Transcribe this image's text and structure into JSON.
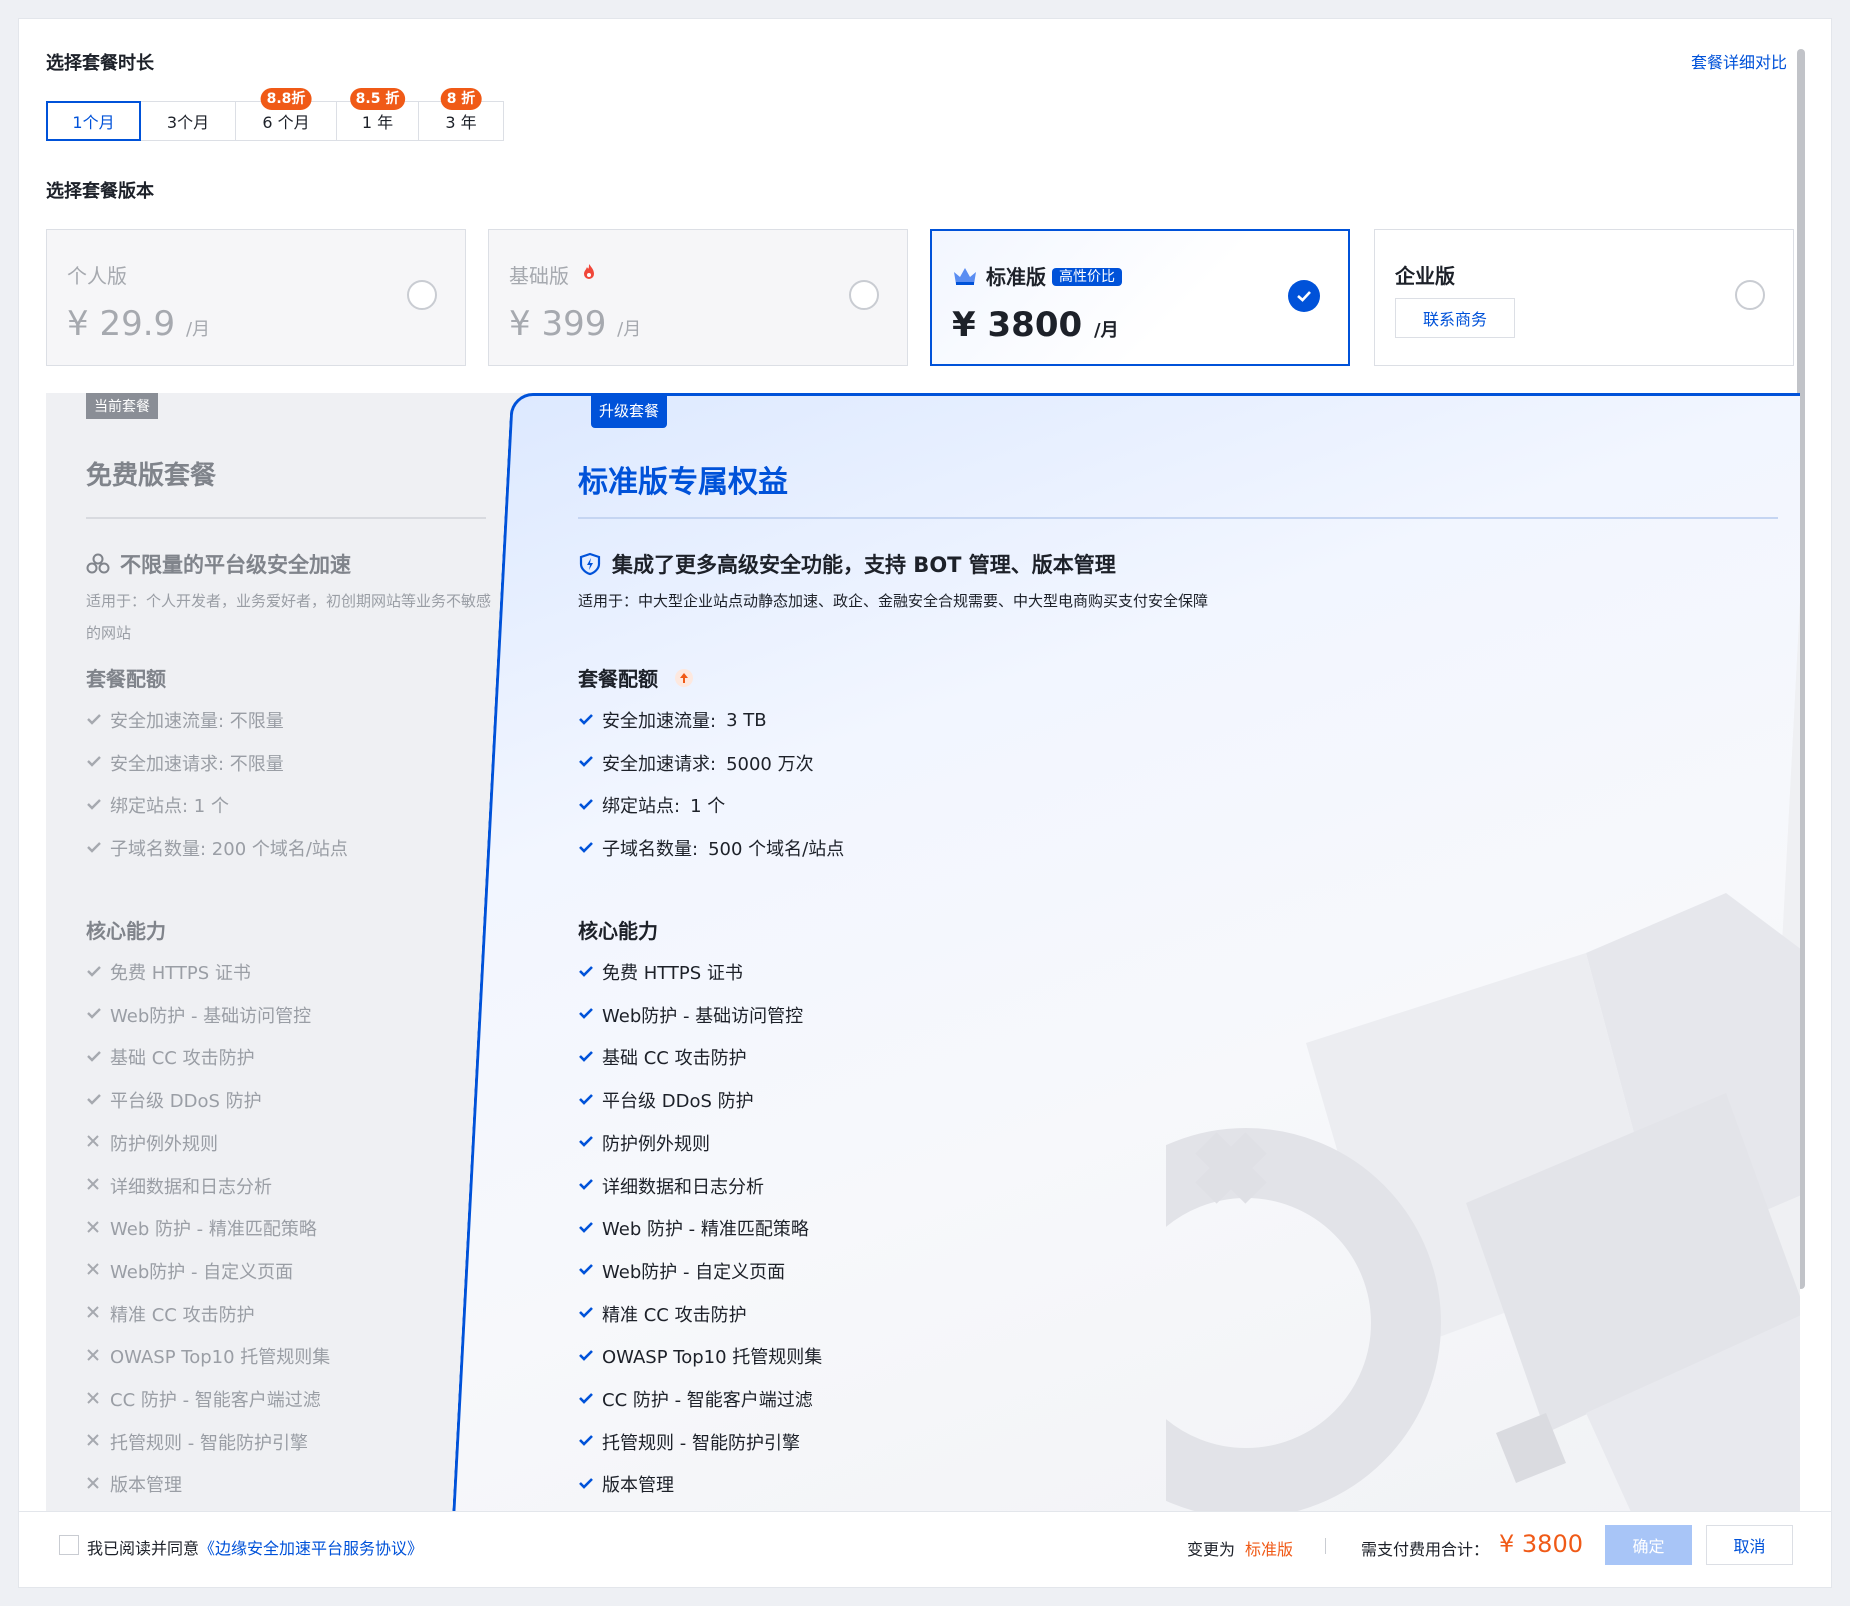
{
  "duration": {
    "title": "选择套餐时长",
    "compare_link": "套餐详细对比",
    "tabs": [
      {
        "label": "1个月",
        "discount": ""
      },
      {
        "label": "3个月",
        "discount": ""
      },
      {
        "label": "6 个月",
        "discount": "8.8折"
      },
      {
        "label": "1 年",
        "discount": "8.5 折"
      },
      {
        "label": "3 年",
        "discount": "8 折"
      }
    ]
  },
  "version": {
    "title": "选择套餐版本",
    "cards": [
      {
        "name": "个人版",
        "currency": "¥",
        "price": "29.9",
        "unit": "/月"
      },
      {
        "name": "基础版",
        "currency": "¥",
        "price": "399",
        "unit": "/月"
      },
      {
        "name": "标准版",
        "badge": "高性价比",
        "currency": "¥",
        "price": "3800",
        "unit": "/月"
      },
      {
        "name": "企业版",
        "button": "联系商务"
      }
    ]
  },
  "current": {
    "badge": "当前套餐",
    "title": "免费版套餐",
    "feature_title": "不限量的平台级安全加速",
    "feature_desc": "适用于：个人开发者，业务爱好者，初创期网站等业务不敏感的网站",
    "quota_title": "套餐配额",
    "quota": [
      "安全加速流量: 不限量",
      "安全加速请求: 不限量",
      "绑定站点: 1 个",
      "子域名数量: 200 个域名/站点"
    ],
    "core_title": "核心能力",
    "core": [
      {
        "text": "免费 HTTPS 证书",
        "included": true
      },
      {
        "text": "Web防护 - 基础访问管控",
        "included": true
      },
      {
        "text": "基础 CC 攻击防护",
        "included": true
      },
      {
        "text": "平台级 DDoS 防护",
        "included": true
      },
      {
        "text": "防护例外规则",
        "included": false
      },
      {
        "text": "详细数据和日志分析",
        "included": false
      },
      {
        "text": "Web 防护 - 精准匹配策略",
        "included": false
      },
      {
        "text": "Web防护 - 自定义页面",
        "included": false
      },
      {
        "text": "精准 CC 攻击防护",
        "included": false
      },
      {
        "text": "OWASP Top10 托管规则集",
        "included": false
      },
      {
        "text": "CC 防护 - 智能客户端过滤",
        "included": false
      },
      {
        "text": "托管规则 - 智能防护引擎",
        "included": false
      },
      {
        "text": "版本管理",
        "included": false
      }
    ]
  },
  "upgrade": {
    "badge": "升级套餐",
    "title": "标准版专属权益",
    "feature_title": "集成了更多高级安全功能，支持 BOT 管理、版本管理",
    "feature_desc": "适用于：中大型企业站点动静态加速、政企、金融安全合规需要、中大型电商购买支付安全保障",
    "quota_title": "套餐配额",
    "quota": [
      {
        "label": "安全加速流量:",
        "value": "3 TB"
      },
      {
        "label": "安全加速请求:",
        "value": "5000 万次"
      },
      {
        "label": "绑定站点:",
        "value": "1 个"
      },
      {
        "label": "子域名数量:",
        "value": "500 个域名/站点"
      }
    ],
    "core_title": "核心能力",
    "core": [
      "免费 HTTPS 证书",
      "Web防护 - 基础访问管控",
      "基础 CC 攻击防护",
      "平台级 DDoS 防护",
      "防护例外规则",
      "详细数据和日志分析",
      "Web 防护 - 精准匹配策略",
      "Web防护 - 自定义页面",
      "精准 CC 攻击防护",
      "OWASP Top10 托管规则集",
      "CC 防护 - 智能客户端过滤",
      "托管规则 - 智能防护引擎",
      "版本管理"
    ]
  },
  "footer": {
    "agree_prefix": "我已阅读并同意",
    "agree_link": "《边缘安全加速平台服务协议》",
    "change_label": "变更为",
    "change_value": "标准版",
    "total_label": "需支付费用合计：",
    "total_value": "¥ 3800",
    "ok": "确定",
    "cancel": "取消"
  },
  "colors": {
    "primary": "#0052d9",
    "accent_orange": "#f05a17",
    "disabled_button": "#a8c5f7"
  }
}
